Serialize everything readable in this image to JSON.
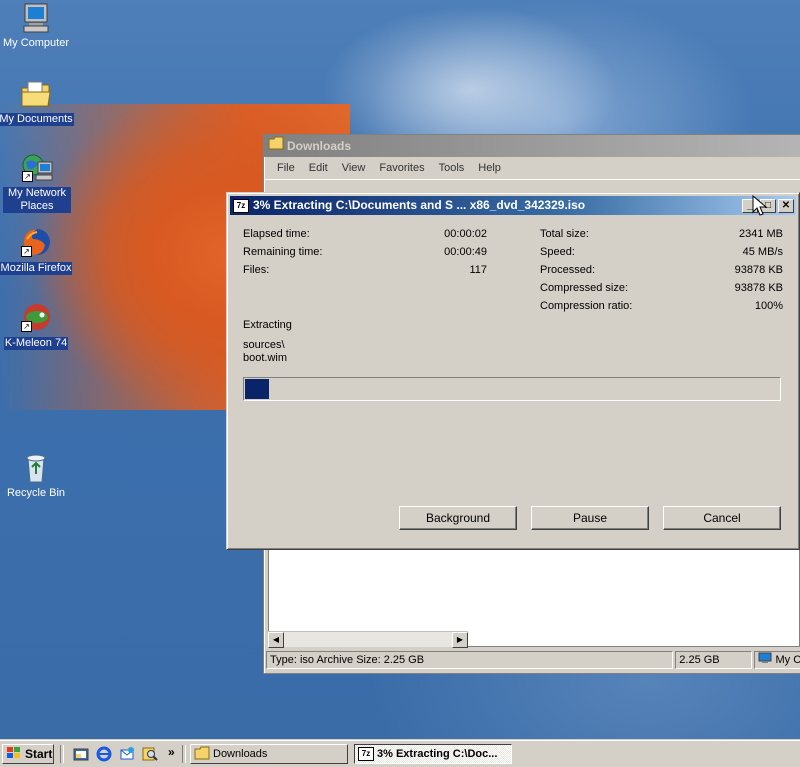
{
  "desktop": {
    "icons": [
      {
        "label": "My Computer",
        "icon": "computer-icon"
      },
      {
        "label": "My Documents",
        "icon": "documents-folder-icon"
      },
      {
        "label": "My Network Places",
        "icon": "network-icon"
      },
      {
        "label": "Mozilla Firefox",
        "icon": "firefox-icon"
      },
      {
        "label": "K-Meleon 74",
        "icon": "kmeleon-icon"
      },
      {
        "label": "Recycle Bin",
        "icon": "recycle-bin-icon"
      }
    ]
  },
  "explorer": {
    "title": "Downloads",
    "menu": [
      "File",
      "Edit",
      "View",
      "Favorites",
      "Tools",
      "Help"
    ],
    "status_left": "Type: iso Archive Size: 2.25 GB",
    "status_size": "2.25 GB",
    "status_zone": "My C"
  },
  "dialog": {
    "title": "3% Extracting C:\\Documents and S ... x86_dvd_342329.iso",
    "app_icon_text": "7z",
    "left_stats": [
      {
        "label": "Elapsed time:",
        "value": "00:00:02"
      },
      {
        "label": "Remaining time:",
        "value": "00:00:49"
      },
      {
        "label": "Files:",
        "value": "117"
      }
    ],
    "right_stats": [
      {
        "label": "Total size:",
        "value": "2341 MB"
      },
      {
        "label": "Speed:",
        "value": "45 MB/s"
      },
      {
        "label": "Processed:",
        "value": "93878 KB"
      },
      {
        "label": "Compressed size:",
        "value": "93878 KB"
      },
      {
        "label": "Compression ratio:",
        "value": "100%"
      }
    ],
    "operation": "Extracting",
    "current_path": "sources\\",
    "current_file": "boot.wim",
    "progress_fraction": 0.045,
    "buttons": {
      "background": "Background",
      "pause": "Pause",
      "cancel": "Cancel"
    }
  },
  "taskbar": {
    "start_label": "Start",
    "tasks": [
      {
        "label": "Downloads",
        "active": false
      },
      {
        "label": "3% Extracting C:\\Doc...",
        "active": true
      }
    ],
    "chevron": "»"
  }
}
